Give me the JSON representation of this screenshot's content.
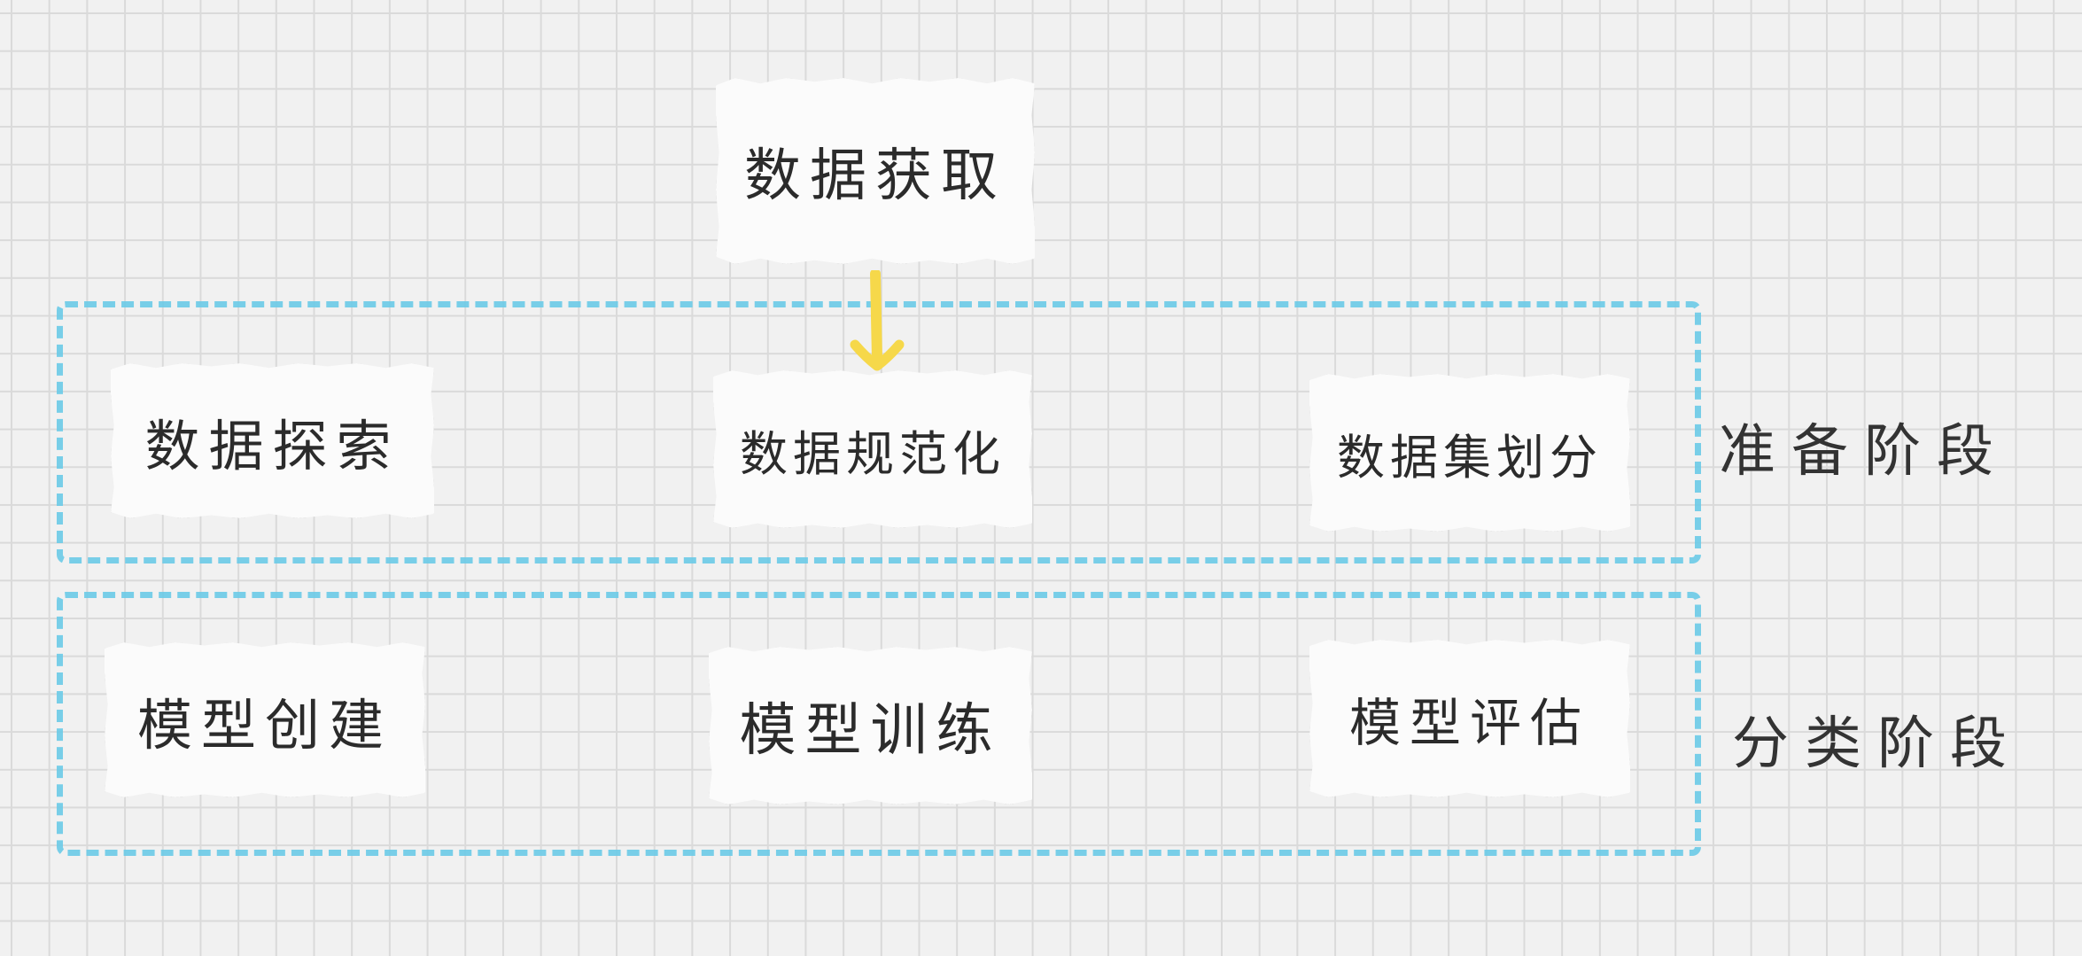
{
  "nodes": {
    "data_acquisition": "数据获取",
    "data_exploration": "数据探索",
    "data_normalization": "数据规范化",
    "dataset_split": "数据集划分",
    "model_creation": "模型创建",
    "model_training": "模型训练",
    "model_evaluation": "模型评估"
  },
  "stages": {
    "preparation": "准备阶段",
    "classification": "分类阶段"
  },
  "colors": {
    "dashed_border": "#6ccbe8",
    "arrow": "#f6d84a",
    "paper": "#fbfbfb",
    "grid": "#dadada",
    "background": "#f1f1f1"
  }
}
